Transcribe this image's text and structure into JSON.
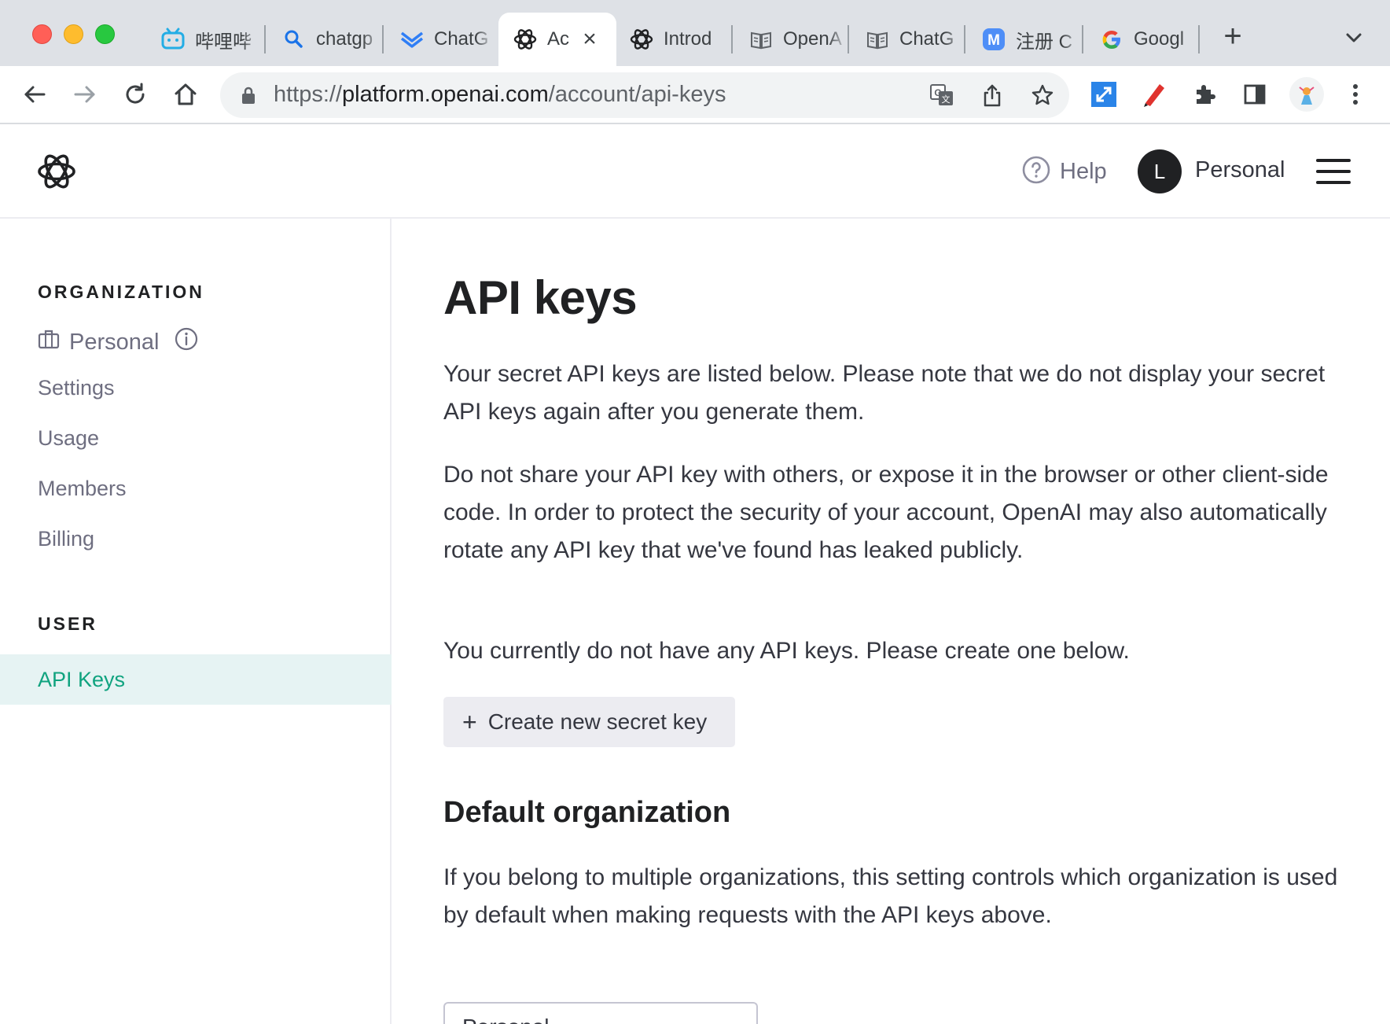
{
  "browser": {
    "tabs": [
      {
        "title": "哔哩哔",
        "icon": "bilibili-icon"
      },
      {
        "title": "chatgp",
        "icon": "search-icon"
      },
      {
        "title": "ChatG",
        "icon": "chevron-logo-icon"
      },
      {
        "title": "Ac",
        "icon": "openai-icon",
        "active": true
      },
      {
        "title": "Introd",
        "icon": "openai-icon"
      },
      {
        "title": "OpenA",
        "icon": "book-icon"
      },
      {
        "title": "ChatG",
        "icon": "book-icon"
      },
      {
        "title": "注册 C",
        "icon": "m-icon"
      },
      {
        "title": "Googl",
        "icon": "google-icon"
      }
    ],
    "new_tab": "+",
    "url": {
      "scheme": "https://",
      "host": "platform.openai.com",
      "path": "/account/api-keys"
    }
  },
  "header": {
    "help_label": "Help",
    "avatar_initial": "L",
    "account_name": "Personal"
  },
  "sidebar": {
    "org_heading": "ORGANIZATION",
    "org_name": "Personal",
    "items": [
      "Settings",
      "Usage",
      "Members",
      "Billing"
    ],
    "user_heading": "USER",
    "active_item": "API Keys"
  },
  "main": {
    "title": "API keys",
    "para1": "Your secret API keys are listed below. Please note that we do not display your secret API keys again after you generate them.",
    "para2": "Do not share your API key with others, or expose it in the browser or other client-side code. In order to protect the security of your account, OpenAI may also automatically rotate any API key that we've found has leaked publicly.",
    "para3": "You currently do not have any API keys. Please create one below.",
    "create_button": "Create new secret key",
    "default_org_title": "Default organization",
    "default_org_text": "If you belong to multiple organizations, this setting controls which organization is used by default when making requests with the API keys above.",
    "default_org_value": "Personal"
  },
  "colors": {
    "accent": "#10a37f",
    "active_bg": "#e6f3f3",
    "tabstrip": "#dee1e6"
  }
}
